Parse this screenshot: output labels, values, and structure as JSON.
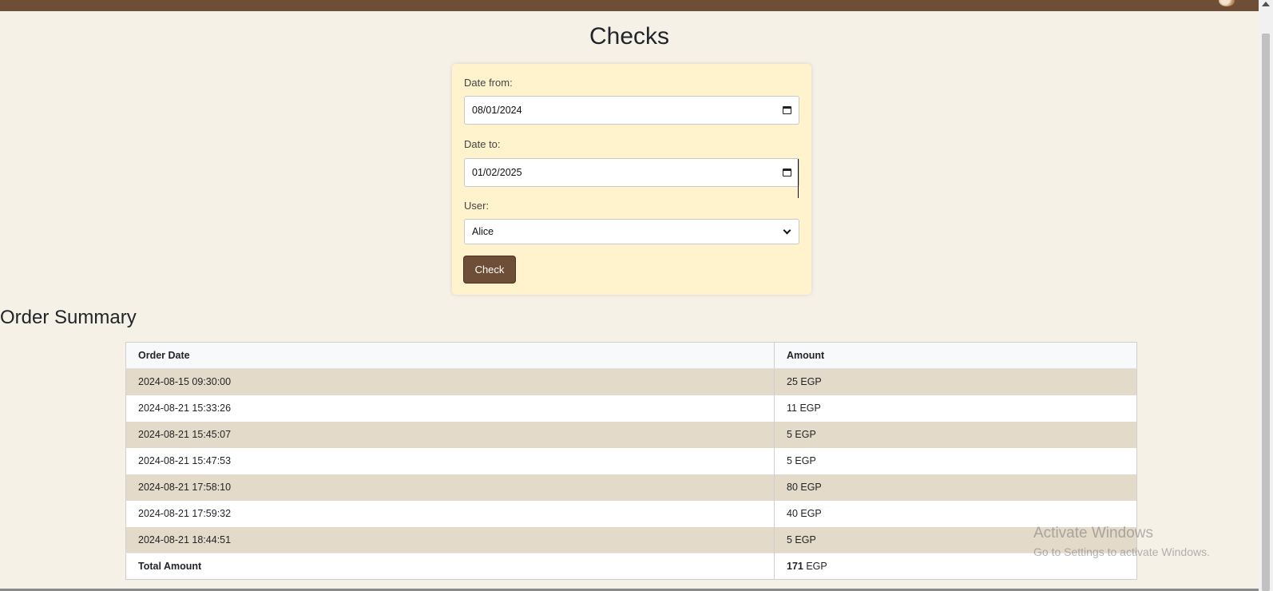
{
  "page": {
    "title": "Checks"
  },
  "form": {
    "date_from_label": "Date from:",
    "date_from_value": "08/01/2024",
    "date_to_label": "Date to:",
    "date_to_value": "01/02/2025",
    "user_label": "User:",
    "user_value": "Alice",
    "check_button": "Check"
  },
  "summary": {
    "title": "Order Summary",
    "columns": [
      "Order Date",
      "Amount"
    ],
    "rows": [
      {
        "date": "2024-08-15 09:30:00",
        "amount": "25 EGP"
      },
      {
        "date": "2024-08-21 15:33:26",
        "amount": "11 EGP"
      },
      {
        "date": "2024-08-21 15:45:07",
        "amount": "5 EGP"
      },
      {
        "date": "2024-08-21 15:47:53",
        "amount": "5 EGP"
      },
      {
        "date": "2024-08-21 17:58:10",
        "amount": "80 EGP"
      },
      {
        "date": "2024-08-21 17:59:32",
        "amount": "40 EGP"
      },
      {
        "date": "2024-08-21 18:44:51",
        "amount": "5 EGP"
      }
    ],
    "total_label": "Total Amount",
    "total_number": "171",
    "total_currency": "EGP"
  },
  "watermark": {
    "title": "Activate Windows",
    "subtitle": "Go to Settings to activate Windows."
  },
  "colors": {
    "brand": "#6f4e37",
    "card": "#fff3cd",
    "row_alt": "#e3dac9",
    "background": "#f6f1e7"
  },
  "icons": {
    "date_picker": "calendar-icon",
    "select": "chevron-down-icon",
    "user": "avatar-icon"
  }
}
